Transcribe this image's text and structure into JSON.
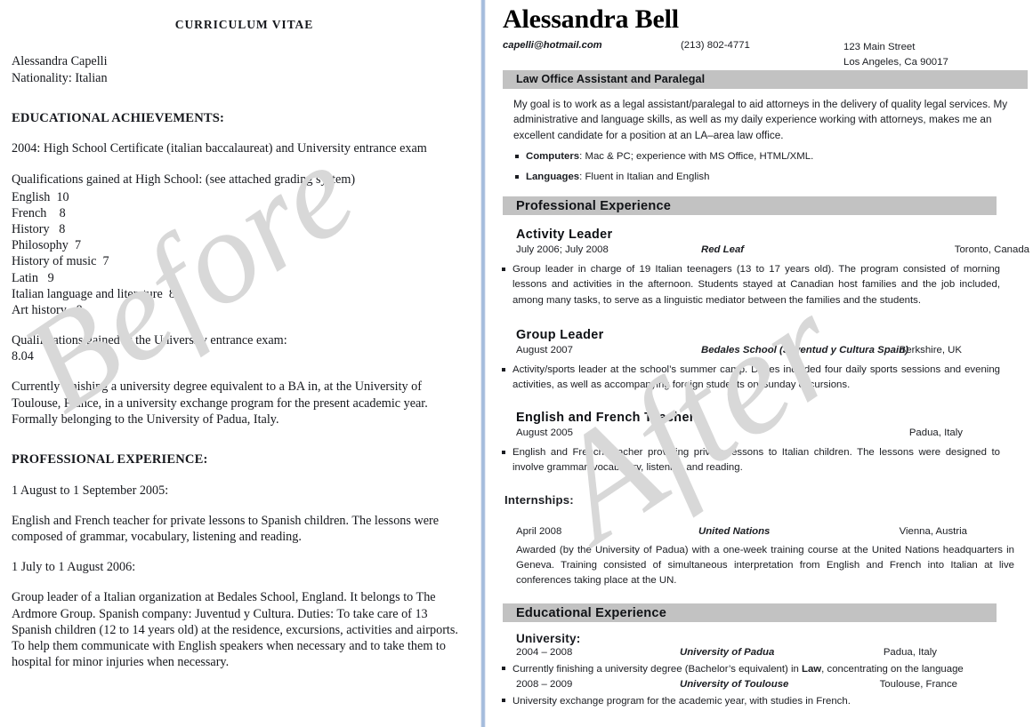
{
  "watermarks": {
    "before": "Before",
    "after": "After"
  },
  "before": {
    "title": "CURRICULUM VITAE",
    "name": "Alessandra Capelli",
    "nationality": "Nationality: Italian",
    "education_heading": "EDUCATIONAL ACHIEVEMENTS:",
    "education_line": "2004: High School Certificate (italian baccalaureat) and University entrance exam",
    "qualifications_heading": "Qualifications gained at High School: (see attached grading system)",
    "grades": [
      "English  10",
      "French    8",
      "History   8",
      "Philosophy  7",
      "History of music  7",
      "Latin   9",
      "Italian language and literature  8",
      "Art history   8"
    ],
    "entrance_heading": "Qualifications gained at the University entrance exam:",
    "entrance_score": "8.04",
    "current_studies": "Currently finishing a university degree equivalent to a BA in, at the University of Toulouse, France, in a university exchange program for the present academic year. Formally belonging to the University of Padua, Italy.",
    "professional_heading": "PROFESSIONAL EXPERIENCE:",
    "job1_date": "1 August to 1 September 2005:",
    "job1_desc": "English and French teacher for private lessons to Spanish children. The lessons were composed of grammar, vocabulary, listening and reading.",
    "job2_date": "1 July to 1 August 2006:",
    "job2_desc": "Group leader of a Italian organization at Bedales School, England. It belongs to The Ardmore Group. Spanish company: Juventud y Cultura. Duties: To take care of 13 Spanish children (12 to 14 years old) at the residence, excursions, activities and airports. To help them communicate with English speakers when necessary and to take them to hospital for minor injuries when necessary."
  },
  "after": {
    "name": "Alessandra Bell",
    "email": "capelli@hotmail.com",
    "phone": "(213) 802-4771",
    "address_line1": "123 Main Street",
    "address_line2": "Los Angeles, Ca 90017",
    "headline_bar": "Law Office Assistant and Paralegal",
    "summary": "My goal is to work as a legal assistant/paralegal to aid attorneys in the delivery of quality legal services. My administrative and language skills, as well as my daily experience working with attorneys, makes me an excellent candidate for a position at an LA–area law office.",
    "skills": [
      {
        "label": "Computers",
        "value": ": Mac & PC; experience with MS Office, HTML/XML."
      },
      {
        "label": "Languages",
        "value": ": Fluent in Italian and English"
      }
    ],
    "experience_bar": "Professional Experience",
    "jobs": [
      {
        "title": "Activity Leader",
        "date": "July 2006; July 2008",
        "org": "Red Leaf",
        "location": "Toronto, Canada",
        "bullet": "Group leader in charge of 19 Italian teenagers (13 to 17 years old). The program consisted of morning lessons and activities in the afternoon. Students stayed at Canadian host families and the job included, among many tasks, to serve as a linguistic mediator between the families and the students."
      },
      {
        "title": "Group Leader",
        "date": "August 2007",
        "org": "Bedales School (Juventud y Cultura Spain)",
        "location": "Berkshire, UK",
        "bullet": "Activity/sports leader at the school’s summer camp. Duties included four daily sports sessions and evening activities, as well as accompanying foreign students on Sunday excursions."
      },
      {
        "title": "English and French Teacher",
        "date": "August 2005",
        "org": "",
        "location": "Padua, Italy",
        "bullet": "English and French teacher providing private lessons to Italian children. The lessons were designed to involve grammar, vocabulary, listening and reading."
      }
    ],
    "internships_heading": "Internships:",
    "internship": {
      "date": "April 2008",
      "org": "United Nations",
      "location": "Vienna, Austria",
      "description": "Awarded (by the University of Padua) with a one-week training course at the United Nations headquarters in Geneva. Training consisted of simultaneous interpretation from English and French into Italian at live conferences taking place at the UN."
    },
    "education_bar": "Educational Experience",
    "university_heading": "University:",
    "education": [
      {
        "date": "2004 – 2008",
        "org": "University of Padua",
        "location": "Padua, Italy",
        "bullet_pre": "Currently finishing a university degree (Bachelor’s equivalent) in ",
        "bullet_bold": "Law",
        "bullet_post": ", concentrating on the language"
      },
      {
        "date": "2008 – 2009",
        "org": "University of Toulouse",
        "location": "Toulouse, France",
        "bullet_pre": "University exchange program for the academic year, with studies in French.",
        "bullet_bold": "",
        "bullet_post": ""
      }
    ]
  },
  "colors": {
    "bar_gray": "#c2c2c2",
    "divider_blue": "#92aed4",
    "watermark_gray": "#d8d8d8"
  }
}
